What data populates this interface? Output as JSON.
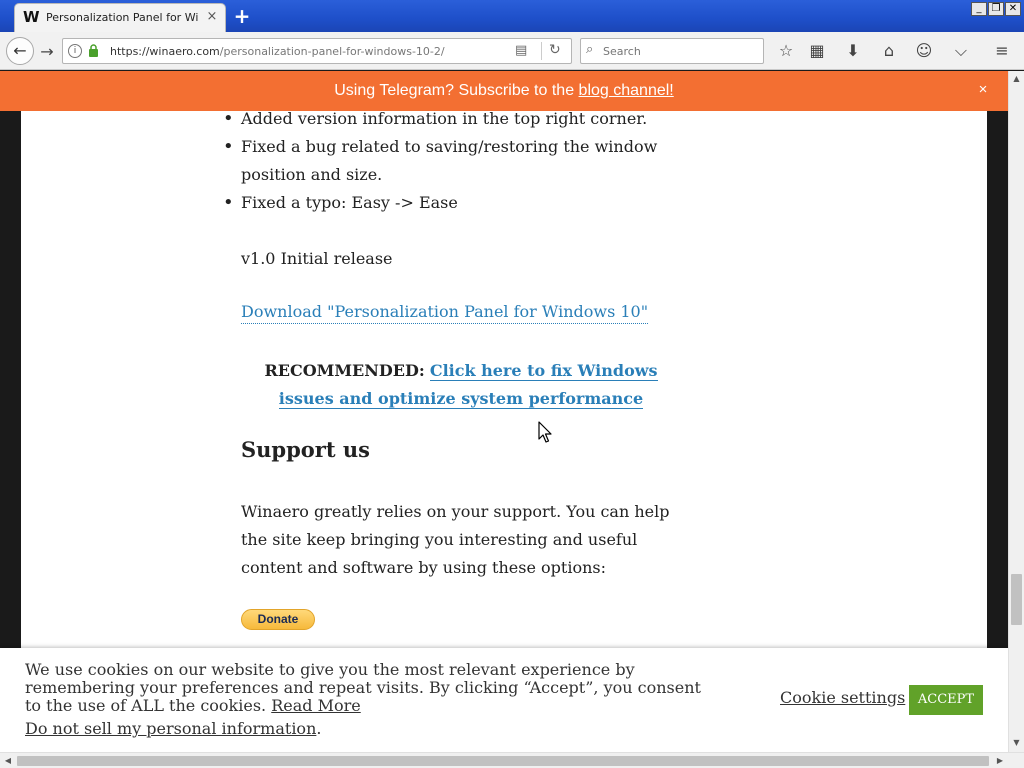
{
  "browser": {
    "tab_title": "Personalization Panel for Win...",
    "favicon_letter": "W",
    "tab_close": "×",
    "new_tab": "+",
    "window_controls": {
      "minimize": "_",
      "restore": "❐",
      "close": "✕"
    },
    "url_host": "https://winaero.com",
    "url_path": "/personalization-panel-for-windows-10-2/",
    "search_placeholder": "Search",
    "icons": [
      "back-icon",
      "forward-icon",
      "info-icon",
      "lock-icon",
      "reader-icon",
      "reload-icon",
      "search-icon",
      "bookmark-star-icon",
      "library-icon",
      "download-icon",
      "home-icon",
      "smiley-icon",
      "pocket-icon",
      "menu-icon"
    ]
  },
  "notification": {
    "message": "Using Telegram? Subscribe to the",
    "link": "blog channel!",
    "close": "×",
    "color": "#f36f32"
  },
  "article": {
    "changelog": [
      "Added version information in the top right corner.",
      "Fixed a bug related to saving/restoring the window position and size.",
      "Fixed a typo: Easy -> Ease"
    ],
    "release": "v1.0 Initial release",
    "download_link": "Download \"Personalization Panel for Windows 10\"",
    "recommended_label": "RECOMMENDED:",
    "recommended_link": "Click here to fix Windows issues and optimize system performance",
    "support_title": "Support us",
    "support_text": "Winaero greatly relies on your support. You can help the site keep bringing you interesting and useful content and software by using these options:",
    "donate_label": "Donate",
    "link_color": "#2a7fb8"
  },
  "cookie_bar": {
    "text": "We use cookies on our website to give you the most relevant experience by remembering your preferences and repeat visits. By clicking “Accept”, you consent to the use of ALL the cookies.",
    "read_more": "Read More",
    "do_not_sell": "Do not sell my personal information",
    "do_not_sell_suffix": ".",
    "settings": "Cookie settings",
    "accept": "ACCEPT",
    "accept_color": "#61a229"
  }
}
